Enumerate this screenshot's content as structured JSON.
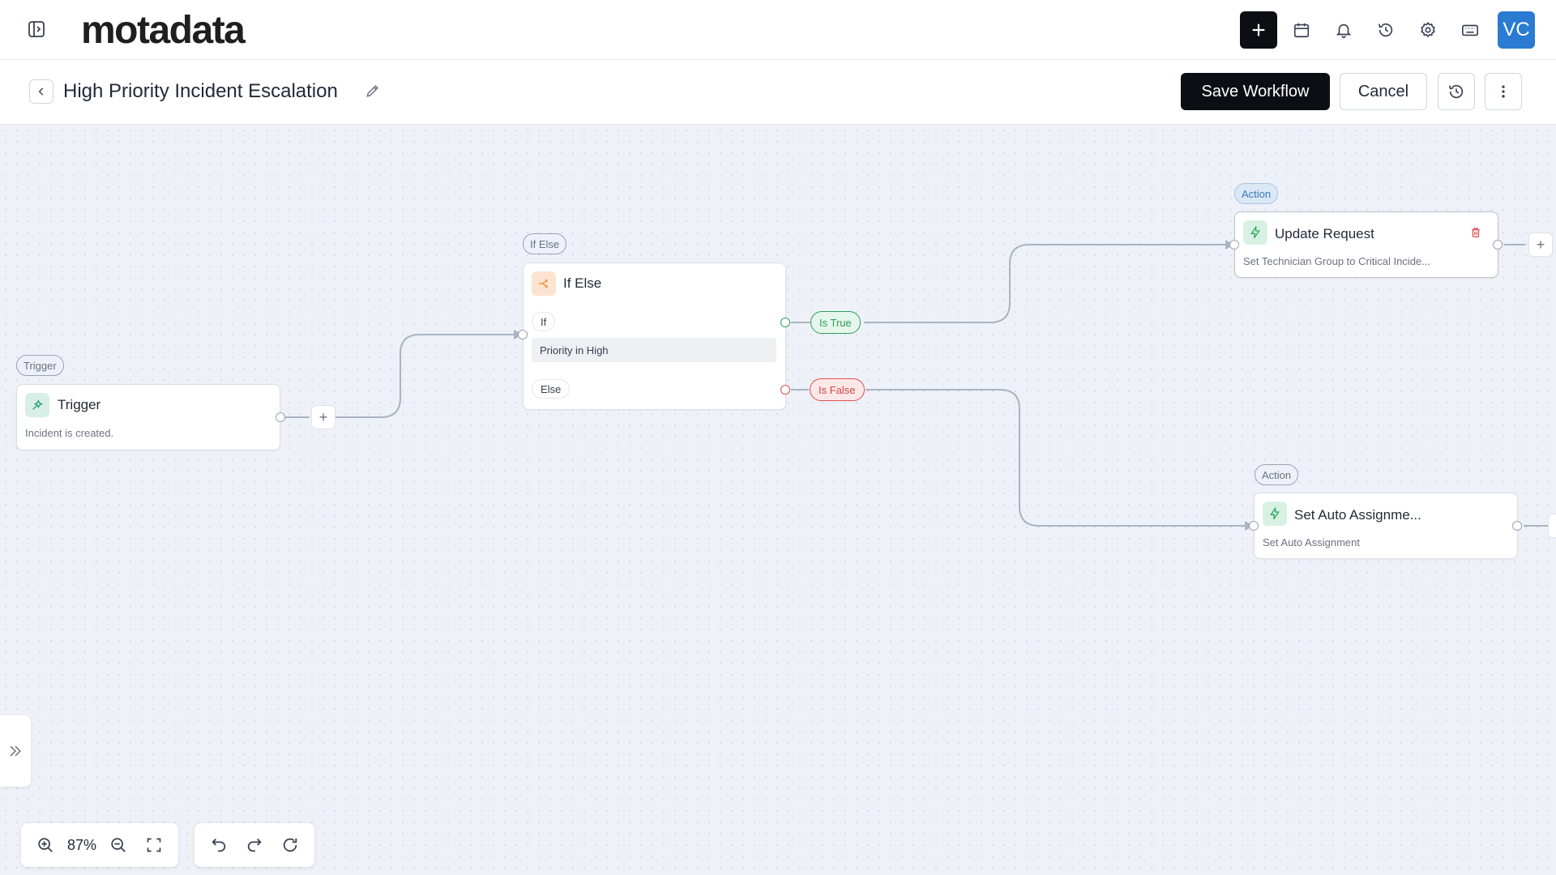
{
  "app": {
    "brand": "motadata",
    "avatar_initials": "VC"
  },
  "header": {
    "icons": [
      "sidebar-toggle-icon",
      "plus-icon",
      "calendar-icon",
      "bell-icon",
      "history-icon",
      "gear-icon",
      "keyboard-icon"
    ]
  },
  "workflow": {
    "title": "High Priority Incident Escalation",
    "save_label": "Save Workflow",
    "cancel_label": "Cancel"
  },
  "nodes": {
    "trigger": {
      "tag": "Trigger",
      "title": "Trigger",
      "description": "Incident is created."
    },
    "ifelse": {
      "tag": "If Else",
      "title": "If Else",
      "if_label": "If",
      "condition": "Priority in High",
      "else_label": "Else"
    },
    "branch_true": "Is True",
    "branch_false": "Is False",
    "update_request": {
      "tag": "Action",
      "title": "Update Request",
      "description": "Set Technician Group to Critical Incide..."
    },
    "auto_assign": {
      "tag": "Action",
      "title": "Set Auto Assignme...",
      "description": "Set Auto Assignment"
    }
  },
  "toolbar": {
    "zoom": "87%"
  },
  "colors": {
    "primary": "#0b0f14",
    "avatar": "#2a7bd1",
    "canvas": "#eef1f7",
    "true_branch": "#2f9e5c",
    "false_branch": "#e05050",
    "ifelse_icon": "#f08a3c",
    "action_icon": "#2eaa5e"
  }
}
